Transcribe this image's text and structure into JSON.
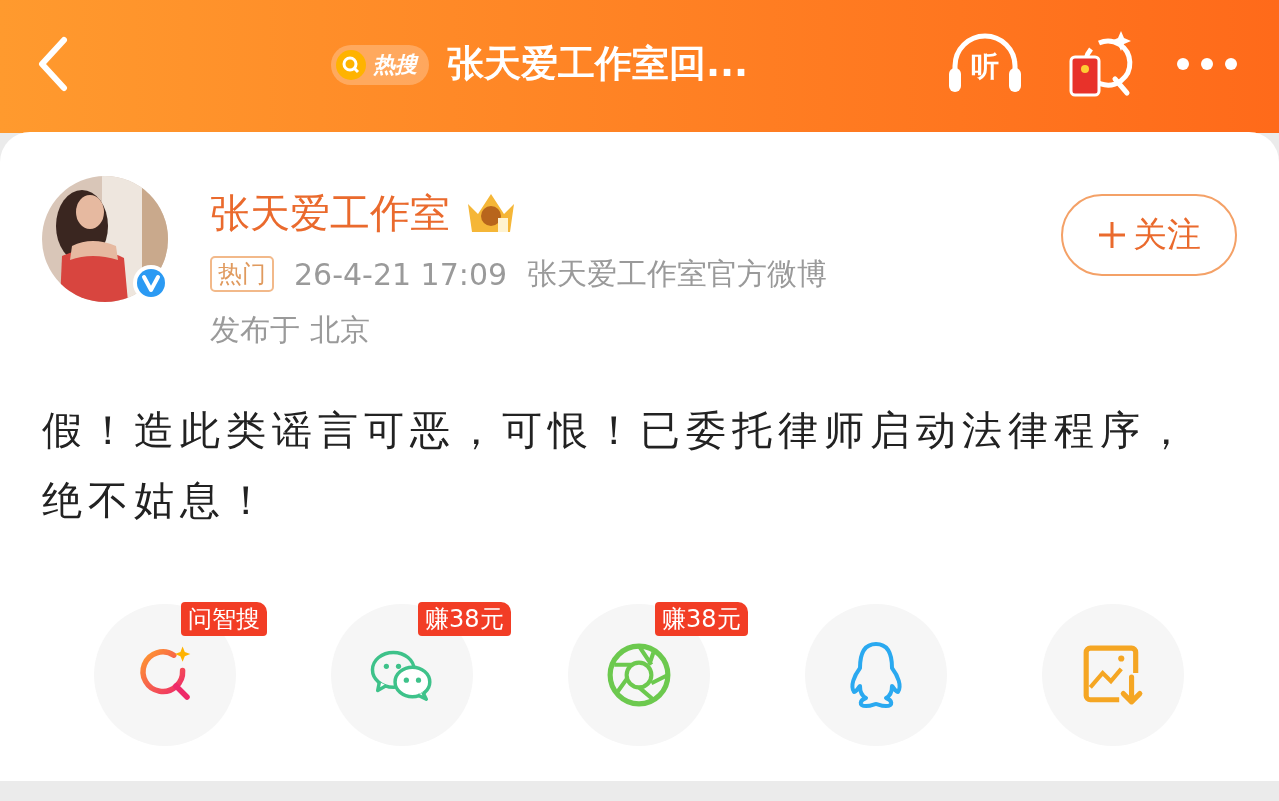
{
  "header": {
    "hot_search_label": "热搜",
    "title": "张天爱工作室回...",
    "listen_label": "听"
  },
  "post": {
    "author": "张天爱工作室",
    "verified": true,
    "tag": "热门",
    "time": "26-4-21 17:09",
    "source": "张天爱工作室官方微博",
    "location": "发布于 北京",
    "follow_label": "关注",
    "text": "假！造此类谣言可恶，可恨！已委托律师启动法律程序，绝不姑息！"
  },
  "share": [
    {
      "kind": "search",
      "badge": "问智搜"
    },
    {
      "kind": "wechat",
      "badge": "赚38元"
    },
    {
      "kind": "moments",
      "badge": "赚38元"
    },
    {
      "kind": "qq"
    },
    {
      "kind": "save-image"
    }
  ]
}
